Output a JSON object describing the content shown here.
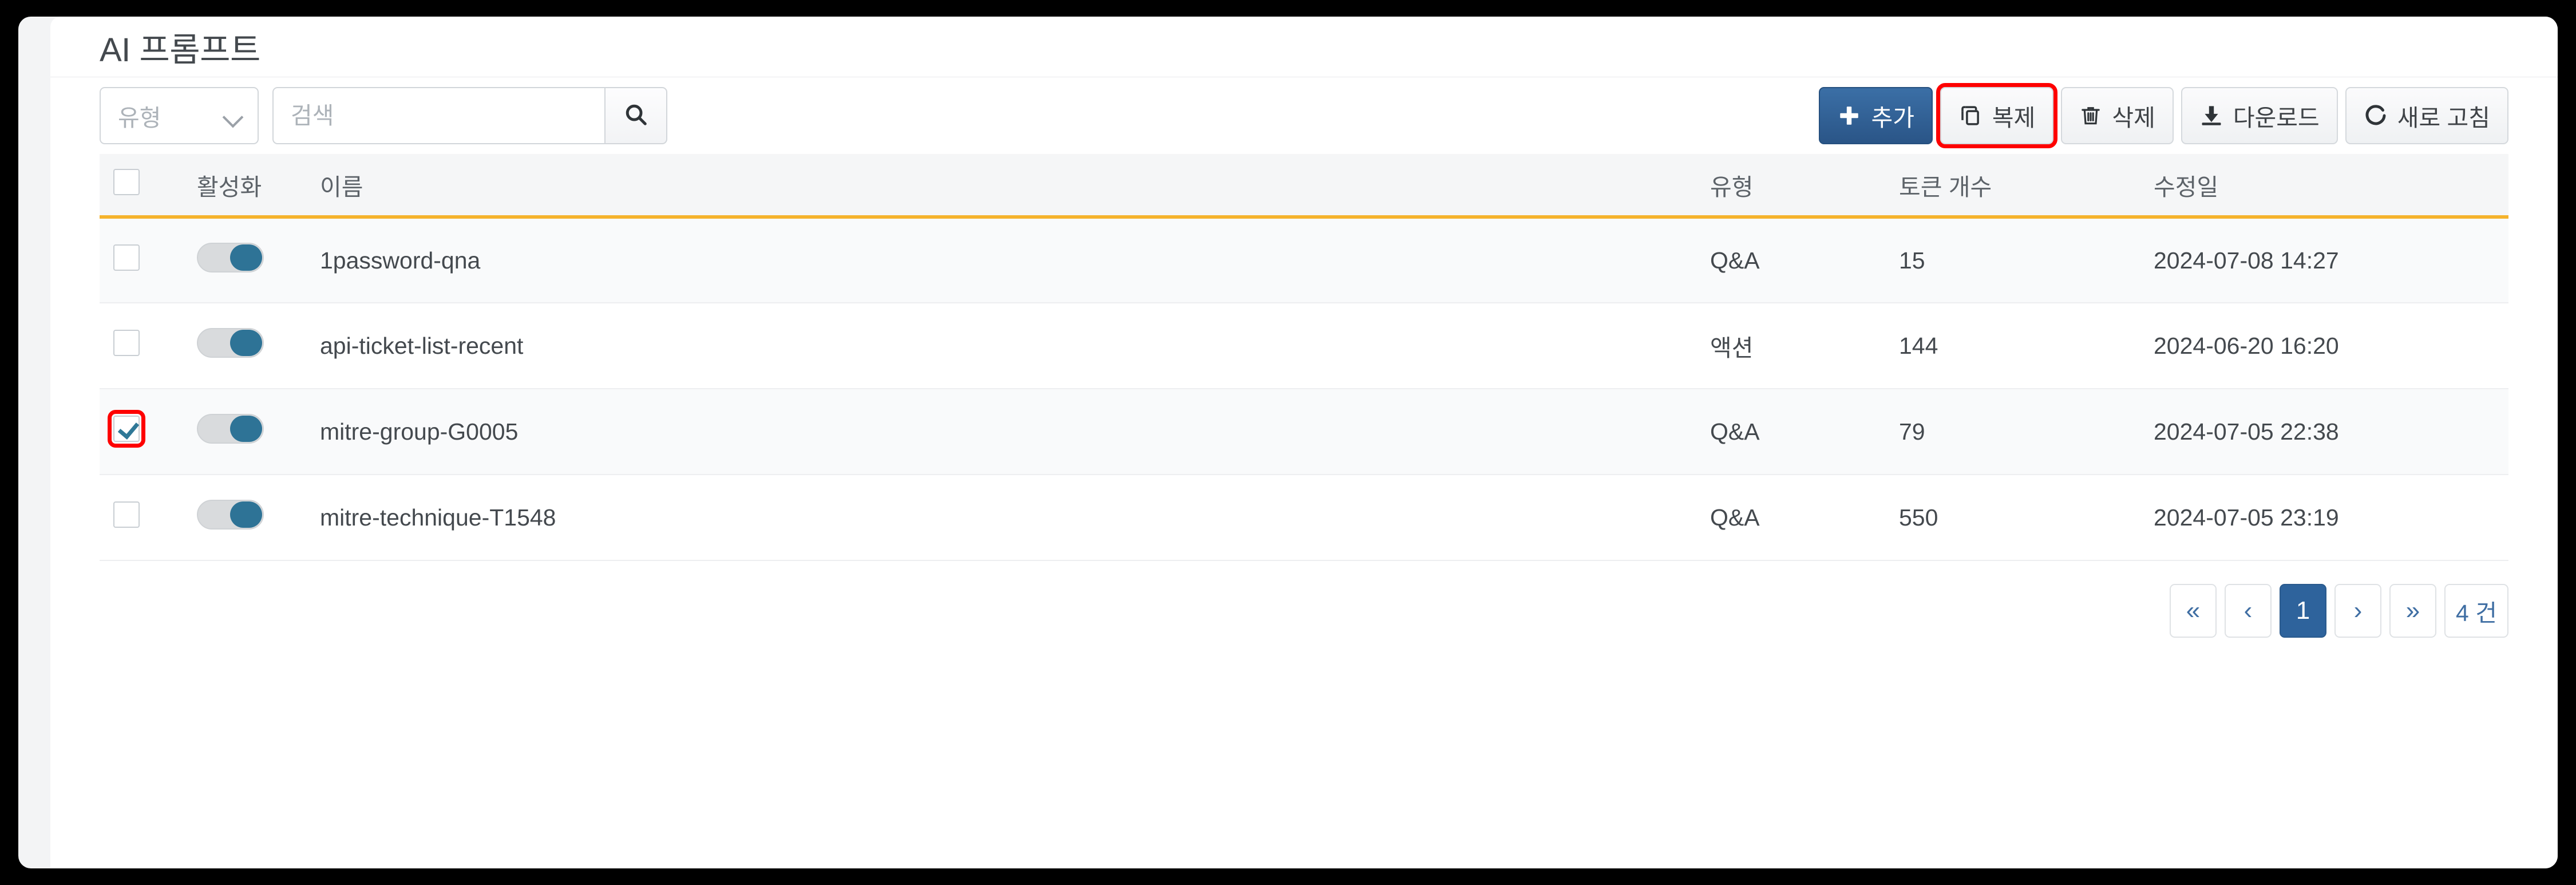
{
  "header": {
    "title": "AI 프롬프트"
  },
  "toolbar": {
    "type_select": {
      "placeholder": "유형",
      "value": "",
      "icon": "chevron-down-icon"
    },
    "search": {
      "placeholder": "검색",
      "value": "",
      "button_icon": "search-icon"
    },
    "buttons": [
      {
        "label": "추가",
        "icon": "plus-icon",
        "style": "primary",
        "highlighted": false
      },
      {
        "label": "복제",
        "icon": "copy-icon",
        "style": "default",
        "highlighted": true
      },
      {
        "label": "삭제",
        "icon": "trash-icon",
        "style": "default",
        "highlighted": false
      },
      {
        "label": "다운로드",
        "icon": "download-icon",
        "style": "default",
        "highlighted": false
      },
      {
        "label": "새로 고침",
        "icon": "refresh-icon",
        "style": "default",
        "highlighted": false
      }
    ]
  },
  "table": {
    "columns": [
      "",
      "활성화",
      "이름",
      "유형",
      "토큰 개수",
      "수정일"
    ],
    "select_all_checked": false,
    "rows": [
      {
        "checked": false,
        "checkbox_highlighted": false,
        "enabled": true,
        "name": "1password-qna",
        "type": "Q&A",
        "tokens": "15",
        "modified": "2024-07-08 14:27"
      },
      {
        "checked": false,
        "checkbox_highlighted": false,
        "enabled": true,
        "name": "api-ticket-list-recent",
        "type": "액션",
        "tokens": "144",
        "modified": "2024-06-20 16:20"
      },
      {
        "checked": true,
        "checkbox_highlighted": true,
        "enabled": true,
        "name": "mitre-group-G0005",
        "type": "Q&A",
        "tokens": "79",
        "modified": "2024-07-05 22:38"
      },
      {
        "checked": false,
        "checkbox_highlighted": false,
        "enabled": true,
        "name": "mitre-technique-T1548",
        "type": "Q&A",
        "tokens": "550",
        "modified": "2024-07-05 23:19"
      }
    ]
  },
  "pagination": {
    "first_label": "«",
    "prev_label": "‹",
    "pages": [
      "1"
    ],
    "active_page": "1",
    "next_label": "›",
    "last_label": "»",
    "total_label": "4 건"
  },
  "colors": {
    "accent_blue": "#2e639c",
    "toggle_on": "#2e7396",
    "header_underline": "#f5b32c",
    "highlight_red": "#fe0000",
    "page_background": "#000000",
    "shell_background": "#f3f4f5"
  }
}
